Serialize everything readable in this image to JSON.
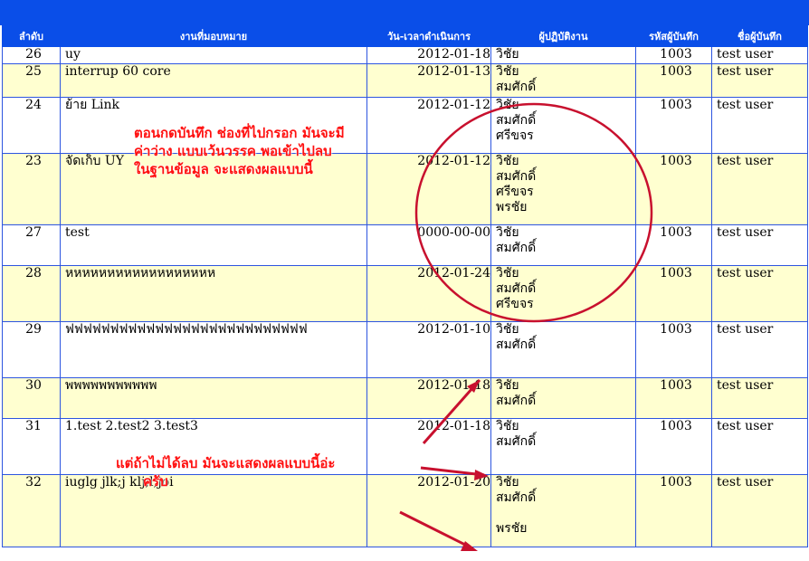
{
  "headers": {
    "no": "ลำดับ",
    "task": "งานที่มอบหมาย",
    "datetime": "วัน-เวลาดำเนินการ",
    "operators": "ผู้ปฏิบัติงาน",
    "recorder_code": "รหัสผู้บันทึก",
    "recorder_name": "ชื่อผู้บันทึก"
  },
  "rows": [
    {
      "no": "26",
      "task": "uy",
      "date": "2012-01-18",
      "names": [
        "วิชัย"
      ],
      "code": "1003",
      "user": "test user"
    },
    {
      "no": "25",
      "task": "interrup 60 core",
      "date": "2012-01-13",
      "names": [
        "วิชัย",
        "สมศักดิ์"
      ],
      "code": "1003",
      "user": "test user"
    },
    {
      "no": "24",
      "task": "ย้าย Link",
      "date": "2012-01-12",
      "names": [
        "วิชัย",
        "สมศักดิ์",
        "ศรีขจร"
      ],
      "code": "1003",
      "user": "test user"
    },
    {
      "no": "23",
      "task": "จัดเก็บ UY",
      "date": "2012-01-12",
      "names": [
        "วิชัย",
        "สมศักดิ์",
        "ศรีขจร",
        "พรชัย"
      ],
      "code": "1003",
      "user": "test user"
    },
    {
      "no": "27",
      "task": "test",
      "date": "0000-00-00",
      "names": [
        "วิชัย",
        "สมศักดิ์"
      ],
      "code": "1003",
      "user": "test user"
    },
    {
      "no": "28",
      "task": "หหหหหหหหหหหหหหหหหห",
      "date": "2012-01-24",
      "names": [
        "วิชัย",
        "สมศักดิ์",
        "ศรีขจร"
      ],
      "code": "1003",
      "user": "test user"
    },
    {
      "no": "29",
      "task": "ฟฟฟฟฟฟฟฟฟฟฟฟฟฟฟฟฟฟฟฟฟฟฟฟฟฟฟ",
      "date": "2012-01-10",
      "names": [
        "วิชัย",
        "สมศักดิ์"
      ],
      "code": "1003",
      "user": "test user"
    },
    {
      "no": "30",
      "task": "พพพพพพพพพพพ",
      "date": "2012-01-18",
      "names": [
        "วิชัย",
        "สมศักดิ์"
      ],
      "code": "1003",
      "user": "test user"
    },
    {
      "no": "31",
      "task": "1.test 2.test2 3.test3",
      "date": "2012-01-18",
      "names": [
        "วิชัย",
        "สมศักดิ์"
      ],
      "code": "1003",
      "user": "test user"
    },
    {
      "no": "32",
      "task": "iuglg jlk;j klj;l;joi",
      "date": "2012-01-20",
      "names": [
        "วิชัย",
        "สมศักดิ์",
        "",
        "พรชัย"
      ],
      "code": "1003",
      "user": "test user"
    }
  ],
  "annotations": {
    "top_note": [
      "ตอนกดบันทึก ช่องที่ไปกรอก มันจะมี",
      "ค่าว่าง แบบเว้นวรรค พอเข้าไปลบ",
      "ในฐานข้อมูล จะแสดงผลแบบนี้"
    ],
    "bottom_note": [
      "แต่ถ้าไม่ได้ลบ มันจะแสดงผลแบบนี้อ่ะ",
      "ครับ"
    ],
    "ink_color": "#c8102e"
  }
}
